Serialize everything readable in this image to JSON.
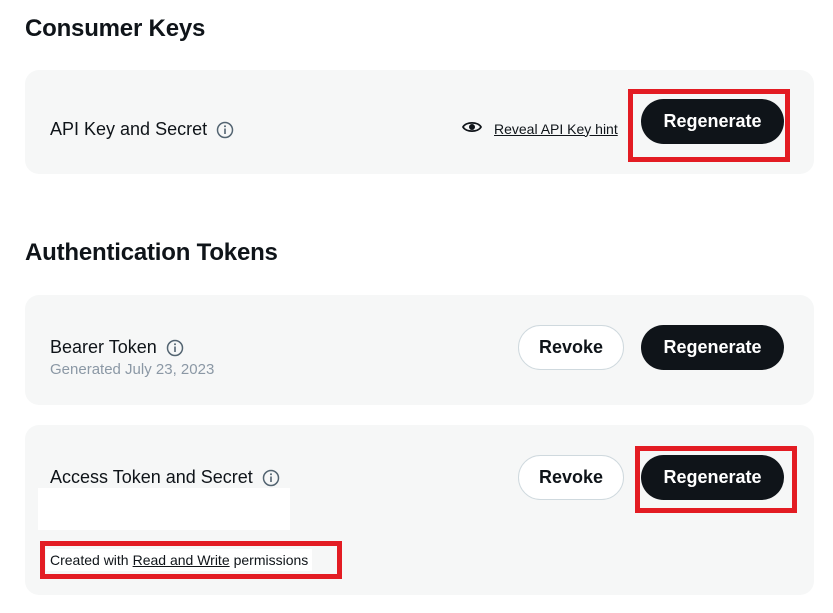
{
  "consumer_keys": {
    "title": "Consumer Keys",
    "api_key": {
      "label": "API Key and Secret",
      "reveal_link": "Reveal API Key hint",
      "regenerate_label": "Regenerate"
    }
  },
  "auth_tokens": {
    "title": "Authentication Tokens",
    "bearer": {
      "label": "Bearer Token",
      "generated": "Generated July 23, 2023",
      "revoke_label": "Revoke",
      "regenerate_label": "Regenerate"
    },
    "access": {
      "label": "Access Token and Secret",
      "revoke_label": "Revoke",
      "regenerate_label": "Regenerate",
      "perm_prefix": "Created with",
      "perm_link": "Read and Write",
      "perm_suffix": "permissions"
    }
  },
  "colors": {
    "highlight": "#e31c23",
    "primary_button": "#0f1419",
    "card_background": "#f6f7f7",
    "muted_text": "#8b98a5"
  },
  "icons": [
    "info-icon",
    "eye-icon"
  ]
}
